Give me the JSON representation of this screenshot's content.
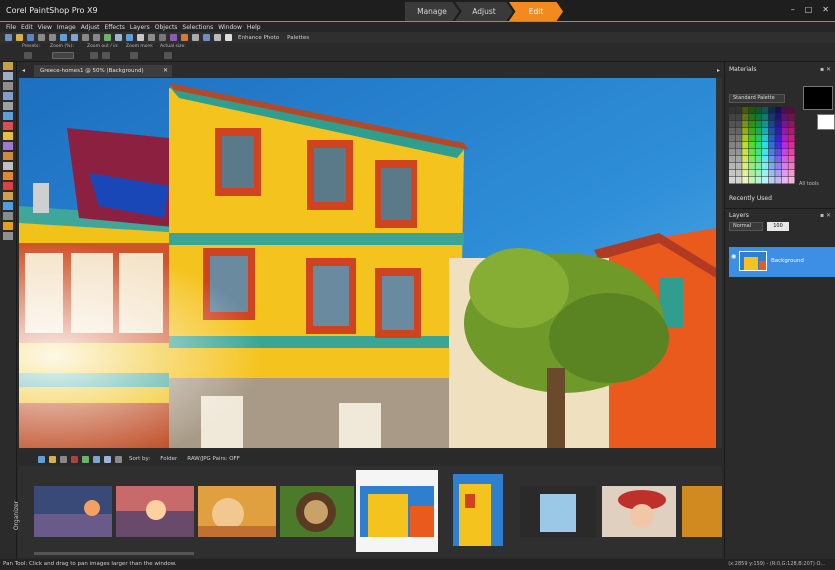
{
  "app": {
    "title": "Corel PaintShop Pro X9",
    "mode_tabs": [
      {
        "label": "Manage",
        "active": false
      },
      {
        "label": "Adjust",
        "active": false
      },
      {
        "label": "Edit",
        "active": true
      }
    ],
    "window_controls": {
      "minimize": "–",
      "maximize": "□",
      "close": "✕"
    }
  },
  "menu": [
    "File",
    "Edit",
    "View",
    "Image",
    "Adjust",
    "Effects",
    "Layers",
    "Objects",
    "Selections",
    "Window",
    "Help"
  ],
  "toolbar": {
    "enhance_photo": "Enhance Photo",
    "palettes": "Palettes"
  },
  "tool_options": {
    "presets": "Presets:",
    "zoom": "Zoom (%):",
    "zoom_out_in": "Zoom out / in:",
    "zoom_more": "Zoom more:",
    "actual_size": "Actual size:"
  },
  "document": {
    "tab_label": "Greece-homes1 @ 50% (Background)",
    "close": "✕"
  },
  "organizer": {
    "side_label": "Organizer",
    "sort_by": "Sort by:",
    "folder": "Folder",
    "raw_filter": "RAW/JPG Pairs: OFF"
  },
  "materials": {
    "title": "Materials",
    "palette_select": "Standard Palette",
    "all_tools": "All tools",
    "recently_used": "Recently Used"
  },
  "layers": {
    "title": "Layers",
    "blend_mode": "Normal",
    "opacity": "100",
    "layer_name": "Background"
  },
  "status": {
    "hint": "Pan Tool: Click and drag to pan images larger than the window.",
    "info": "(x:2859 y:159) - (R:0,G:128,B:207) O..."
  },
  "colors": {
    "accent": "#f28a1e",
    "layer_selected": "#3d8fe6"
  }
}
